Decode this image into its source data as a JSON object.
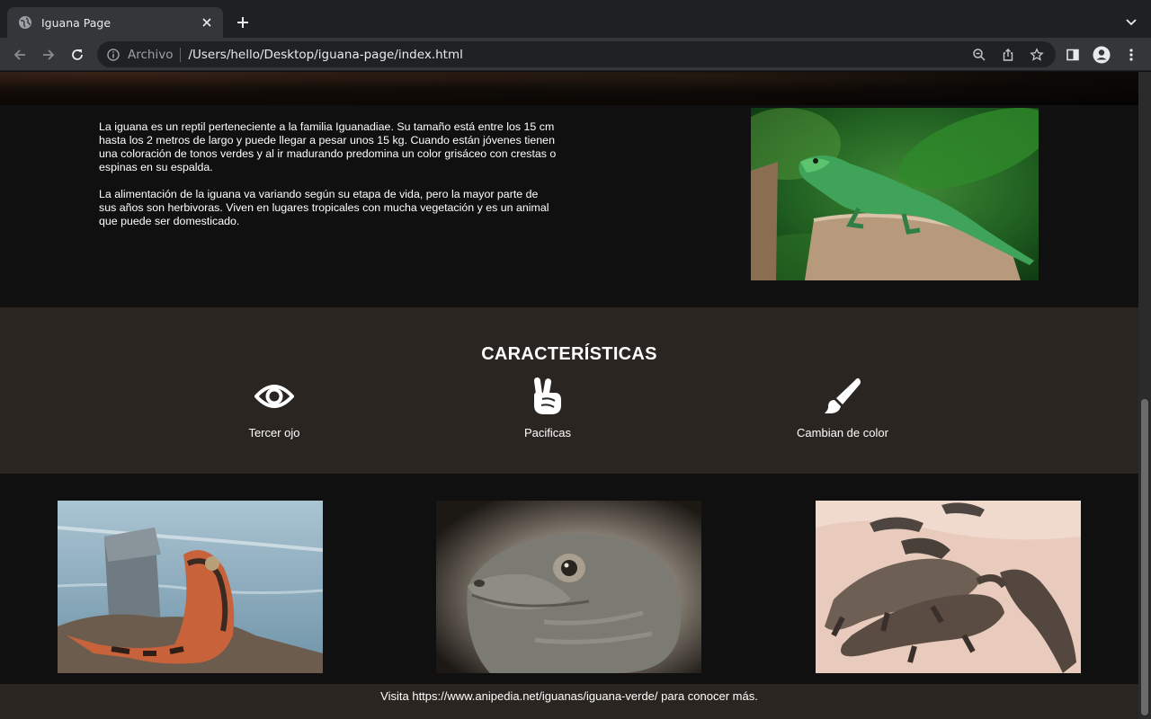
{
  "browser": {
    "tab_title": "Iguana Page",
    "omnibox_scheme": "Archivo",
    "omnibox_url": "/Users/hello/Desktop/iguana-page/index.html"
  },
  "intro": {
    "paragraph_1": "La iguana es un reptil perteneciente a la familia Iguanadiae. Su tamaño está entre los 15 cm hasta los 2 metros de largo y puede llegar a pesar unos 15 kg. Cuando están jóvenes tienen una coloración de tonos verdes y al ir madurando predomina un color grisáceo con crestas o espinas en su espalda.",
    "paragraph_2": "La alimentación de la iguana va variando según su etapa de vida, pero la mayor parte de sus años son herbivoras. Viven en lugares tropicales con mucha vegetación y es un animal que puede ser domesticado."
  },
  "features": {
    "title": "CARACTERÍSTICAS",
    "items": [
      {
        "icon": "eye-icon",
        "label": "Tercer ojo"
      },
      {
        "icon": "peace-hand-icon",
        "label": "Pacificas"
      },
      {
        "icon": "paintbrush-icon",
        "label": "Cambian de color"
      }
    ]
  },
  "footer": {
    "prefix": "Visita",
    "link": "https://www.anipedia.net/iguanas/iguana-verde/",
    "suffix": "para conocer más."
  }
}
